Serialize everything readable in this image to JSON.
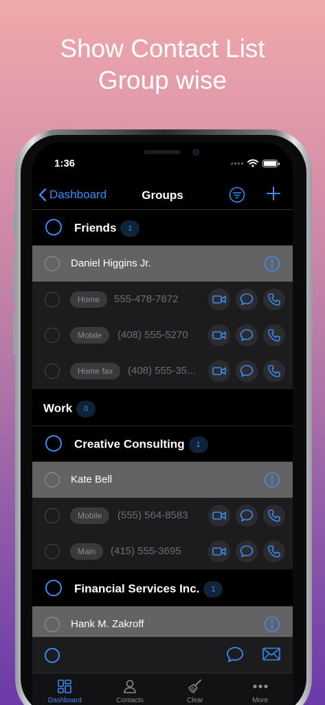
{
  "headline": {
    "line1": "Show Contact List",
    "line2": "Group wise"
  },
  "status": {
    "time": "1:36"
  },
  "nav": {
    "back_label": "Dashboard",
    "title": "Groups"
  },
  "groups": [
    {
      "name": "Friends",
      "count": "1",
      "contacts": [
        {
          "name": "Daniel Higgins Jr.",
          "phones": [
            {
              "label": "Home",
              "number": "555-478-7672"
            },
            {
              "label": "Mobile",
              "number": "(408) 555-5270"
            },
            {
              "label": "Home fax",
              "number": "(408) 555-35..."
            }
          ]
        }
      ]
    },
    {
      "name": "Work",
      "count": "0"
    },
    {
      "name": "Creative Consulting",
      "count": "1",
      "contacts": [
        {
          "name": "Kate Bell",
          "phones": [
            {
              "label": "Mobile",
              "number": "(555) 564-8583"
            },
            {
              "label": "Main",
              "number": "(415) 555-3695"
            }
          ]
        }
      ]
    },
    {
      "name": "Financial Services Inc.",
      "count": "1",
      "contacts": [
        {
          "name": "Hank M. Zakroff"
        }
      ]
    }
  ],
  "tabs": [
    {
      "label": "Dashboard",
      "icon": "dashboard-grid-icon",
      "active": true
    },
    {
      "label": "Contacts",
      "icon": "person-icon",
      "active": false
    },
    {
      "label": "Clear",
      "icon": "broom-icon",
      "active": false
    },
    {
      "label": "More",
      "icon": "ellipsis-icon",
      "active": false
    }
  ],
  "colors": {
    "accent": "#3b8cf5",
    "selected_row": "#636366",
    "phone_row": "#1c1c1e"
  }
}
